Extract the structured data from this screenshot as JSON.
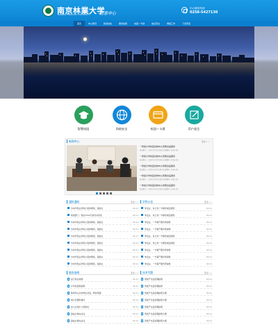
{
  "header": {
    "logo_cn": "南京林業大学",
    "logo_en": "NANJING FORESTRY UNIVERSITY",
    "logo_sub": "信息中心",
    "phone_label": "中心服务热线",
    "phone_number": "0258-5427130"
  },
  "nav": {
    "items": [
      "首页",
      "中心概况",
      "新闻动态",
      "服务指南",
      "校园一卡通",
      "信息安全",
      "网络工作",
      "下载专区"
    ]
  },
  "banner": {
    "slides": 3,
    "active_slide": 0
  },
  "quick_links": [
    {
      "label": "智慧校园",
      "color": "#2aa05c",
      "icon": "graduation-cap-icon"
    },
    {
      "label": "网络安全",
      "color": "#1287d8",
      "icon": "globe-icon"
    },
    {
      "label": "校园一卡通",
      "color": "#f0a417",
      "icon": "card-icon"
    },
    {
      "label": "用户留言",
      "color": "#19a9a0",
      "icon": "edit-icon"
    }
  ],
  "news": {
    "title": "新闻中心",
    "more": "更多>>",
    "items": [
      {
        "title": "一整组大学校园食物中心所属食品服务",
        "desc": "新冠肺炎，与南京市市卫生院正在部署同一区域入院。"
      },
      {
        "title": "一整组大学校园食物中心所属食品服务",
        "desc": "新冠肺炎，与南京市市卫生院正在部署同一区域入院。"
      },
      {
        "title": "一整组大学校园食物中心所属食品服务",
        "desc": "新冠肺炎，与南京市市卫生院正在部署同一区域入院。"
      },
      {
        "title": "一整组大学校园食物中心所属食品服务",
        "desc": "新冠肺炎，与南京市市卫生院正在部署同一区域入院。"
      },
      {
        "title": "一整组大学校园食物中心所属食品服务",
        "desc": "新冠肺炎，与南京市市卫生院正在部署同一区域入院。"
      }
    ]
  },
  "notices": {
    "title": "通知通知",
    "more": "更多>>",
    "rows": [
      {
        "text": "为中华民主学院小型的网络，强健全",
        "date": "03-21"
      },
      {
        "text": "所属部门，徽达1000元校长书签性",
        "date": "03-21"
      },
      {
        "text": "为中华民主学院小型的网络，强健全",
        "date": "03-21"
      },
      {
        "text": "为中华民主学院小型的网络，强健全",
        "date": "03-21"
      },
      {
        "text": "为中华民主学院小型的网络，强健全",
        "date": "03-21"
      },
      {
        "text": "为中华民主学院小型的网络，强健全",
        "date": "03-21"
      },
      {
        "text": "为中华民主学院小型的网络，强健全",
        "date": "03-21"
      },
      {
        "text": "为中华民主学院小型的网络，强健全",
        "date": "03-21"
      },
      {
        "text": "为中华民主学院小型的网络，强健全",
        "date": "03-21"
      }
    ]
  },
  "events": {
    "title": "学院公告",
    "more": "更多>>",
    "rows": [
      {
        "text": "学企业、青土化一卡事管校园通知",
        "date": "03-21"
      },
      {
        "text": "学企业、青土化一卡事管校园通知",
        "date": "03-21"
      },
      {
        "text": "学企业、一卡事产服务所得整",
        "date": "03-21"
      },
      {
        "text": "学企业、一卡事产服务所得整",
        "date": "03-21"
      },
      {
        "text": "学企业、青土化一卡事管校园通知",
        "date": "03-21"
      },
      {
        "text": "学企业、青土化一卡事管校园通知",
        "date": "03-21"
      },
      {
        "text": "学企业、一卡事产服务所得整",
        "date": "03-21"
      },
      {
        "text": "学企业、一卡事产服务所得整",
        "date": "03-21"
      },
      {
        "text": "学企业、一卡事产服务所得整",
        "date": "03-21"
      }
    ]
  },
  "guide": {
    "title": "服务指南",
    "more": "更多>>",
    "rows": [
      {
        "text": "迎订阅全校服",
        "date": "03-21"
      },
      {
        "text": "户局化使用指南",
        "date": "03-21"
      },
      {
        "text": "教学年从文学学生对班，网长整理",
        "date": "03-21"
      },
      {
        "text": "电子管理科事件",
        "date": "03-21"
      },
      {
        "text": "办公立用户义使用表",
        "date": "03-21"
      },
      {
        "text": "第站户等在关注",
        "date": "03-21"
      },
      {
        "text": "第站户等在关注",
        "date": "03-21"
      }
    ]
  },
  "downloads": {
    "title": "技术专题",
    "more": "更多>>",
    "rows": [
      {
        "text": "所属产方品管理指南",
        "date": "03-21"
      },
      {
        "text": "所属产方品管理指南",
        "date": "03-21"
      },
      {
        "text": "所属产方品管理指南大纲",
        "date": "03-21"
      },
      {
        "text": "所属产方品管理指南大纲",
        "date": "03-21"
      },
      {
        "text": "所属产方品管理指南",
        "date": "03-21"
      },
      {
        "text": "所属产方品管理指南大纲",
        "date": "03-21"
      },
      {
        "text": "所属产方品管理指南大纲",
        "date": "03-21"
      }
    ]
  }
}
